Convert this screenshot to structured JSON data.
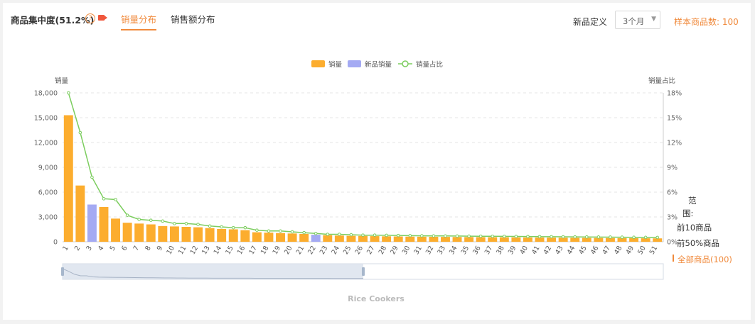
{
  "header": {
    "title": "商品集中度(51.2%)",
    "help_icon": "?",
    "tabs": [
      {
        "label": "销量分布",
        "active": true
      },
      {
        "label": "销售额分布",
        "active": false
      }
    ],
    "new_def_label": "新品定义",
    "new_def_value": "3个月",
    "sample_count": "样本商品数: 100"
  },
  "range": {
    "label_line1": "范",
    "label_line2": "围:",
    "options": [
      "前10商品",
      "前50%商品",
      "全部商品(100)"
    ],
    "selected": "全部商品(100)"
  },
  "colors": {
    "sales": "#fcad2e",
    "new": "#a4aaf3",
    "ratio": "#7ccd5f",
    "accent": "#f08a3c"
  },
  "chart_data": {
    "type": "bar",
    "legend": [
      "销量",
      "新品销量",
      "销量占比"
    ],
    "ylabel_left": "销量",
    "ylabel_right": "销量占比",
    "y_left_ticks": [
      "0",
      "3,000",
      "6,000",
      "9,000",
      "12,000",
      "15,000",
      "18,000"
    ],
    "y_right_ticks": [
      "0%",
      "3%",
      "6%",
      "9%",
      "12%",
      "15%",
      "18%"
    ],
    "ylim_left": [
      0,
      18000
    ],
    "ylim_right": [
      0,
      18
    ],
    "grid": true,
    "legend_position": "top-center",
    "categories": [
      "1",
      "2",
      "3",
      "4",
      "5",
      "6",
      "7",
      "8",
      "9",
      "10",
      "11",
      "12",
      "13",
      "14",
      "15",
      "16",
      "17",
      "18",
      "19",
      "20",
      "21",
      "22",
      "23",
      "24",
      "25",
      "26",
      "27",
      "28",
      "29",
      "30",
      "31",
      "32",
      "33",
      "34",
      "35",
      "36",
      "37",
      "38",
      "39",
      "40",
      "41",
      "42",
      "43",
      "44",
      "45",
      "46",
      "47",
      "48",
      "49",
      "50",
      "51"
    ],
    "series": [
      {
        "name": "销量",
        "values": [
          15300,
          6800,
          0,
          4200,
          2800,
          2300,
          2200,
          2100,
          1900,
          1850,
          1800,
          1750,
          1650,
          1550,
          1500,
          1400,
          1150,
          1100,
          1050,
          1000,
          950,
          0,
          800,
          750,
          720,
          700,
          680,
          660,
          640,
          620,
          610,
          600,
          590,
          580,
          570,
          560,
          550,
          540,
          530,
          520,
          510,
          500,
          490,
          480,
          470,
          460,
          450,
          440,
          430,
          420,
          410
        ]
      },
      {
        "name": "新品销量",
        "values": [
          0,
          0,
          4500,
          0,
          0,
          0,
          0,
          0,
          0,
          0,
          0,
          0,
          0,
          0,
          0,
          0,
          0,
          0,
          0,
          0,
          0,
          850,
          0,
          0,
          0,
          0,
          0,
          0,
          0,
          0,
          0,
          0,
          0,
          0,
          0,
          0,
          0,
          0,
          0,
          0,
          0,
          0,
          0,
          0,
          0,
          0,
          0,
          0,
          0,
          0,
          0
        ]
      },
      {
        "name": "销量占比",
        "values": [
          18,
          13.2,
          7.8,
          5.2,
          5.1,
          3.2,
          2.7,
          2.6,
          2.5,
          2.2,
          2.2,
          2.1,
          1.9,
          1.8,
          1.7,
          1.7,
          1.4,
          1.3,
          1.3,
          1.2,
          1.1,
          1.0,
          0.9,
          0.9,
          0.85,
          0.8,
          0.8,
          0.78,
          0.76,
          0.74,
          0.72,
          0.71,
          0.7,
          0.69,
          0.68,
          0.67,
          0.66,
          0.65,
          0.64,
          0.63,
          0.62,
          0.61,
          0.6,
          0.59,
          0.58,
          0.57,
          0.56,
          0.55,
          0.54,
          0.53,
          0.52
        ]
      }
    ],
    "footer_label": "Rice Cookers"
  }
}
